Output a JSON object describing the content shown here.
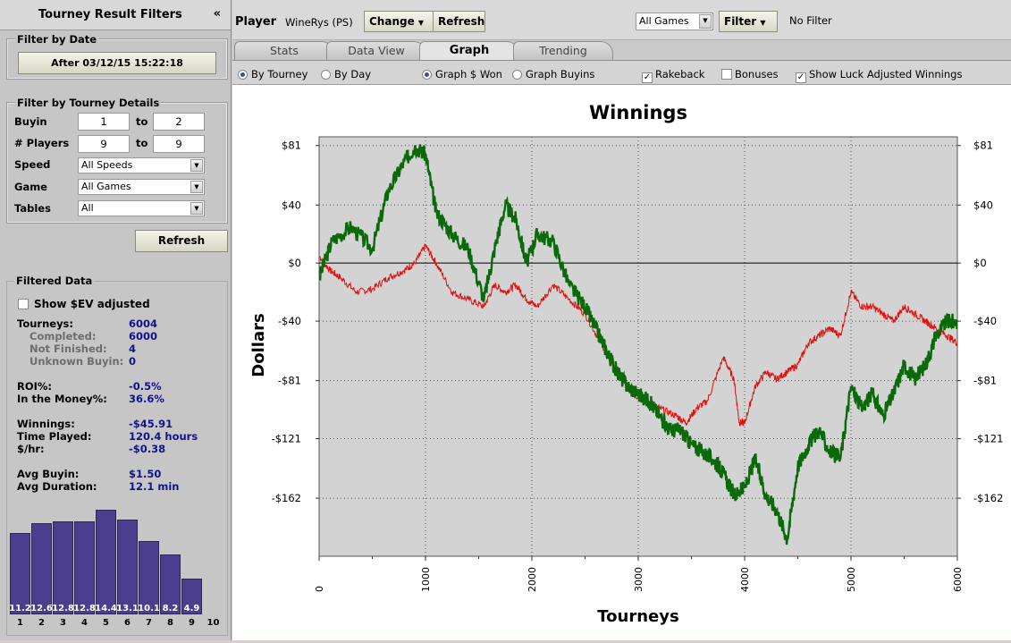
{
  "sidebar": {
    "title": "Tourney Result Filters",
    "collapse_glyph": "«",
    "date_group": {
      "label": "Filter by Date",
      "button": "After 03/12/15 15:22:18"
    },
    "details_group": {
      "label": "Filter by Tourney Details",
      "buyin_label": "Buyin",
      "buyin_from": "1",
      "buyin_to": "2",
      "players_label": "# Players",
      "players_from": "9",
      "players_to": "9",
      "to": "to",
      "speed_label": "Speed",
      "speed_value": "All Speeds",
      "game_label": "Game",
      "game_value": "All Games",
      "tables_label": "Tables",
      "tables_value": "All"
    },
    "refresh": "Refresh",
    "filtered": {
      "label": "Filtered Data",
      "ev_label": "Show $EV adjusted",
      "tourneys_label": "Tourneys:",
      "tourneys": "6004",
      "completed_label": "Completed:",
      "completed": "6000",
      "not_finished_label": "Not Finished:",
      "not_finished": "4",
      "unknown_label": "Unknown Buyin:",
      "unknown": "0",
      "roi_label": "ROI%:",
      "roi": "-0.5%",
      "itm_label": "In the Money%:",
      "itm": "36.6%",
      "winnings_label": "Winnings:",
      "winnings": "-$45.91",
      "time_label": "Time Played:",
      "time": "120.4 hours",
      "hr_label": "$/hr:",
      "hr": "-$0.38",
      "avg_buyin_label": "Avg Buyin:",
      "avg_buyin": "$1.50",
      "avg_dur_label": "Avg Duration:",
      "avg_dur": "12.1 min"
    },
    "histogram": {
      "positions": [
        "1",
        "2",
        "3",
        "4",
        "5",
        "6",
        "7",
        "8",
        "9",
        "10"
      ],
      "values": [
        11.2,
        12.6,
        12.8,
        12.8,
        14.4,
        13.1,
        10.1,
        8.2,
        4.9
      ],
      "labels": [
        "11.2",
        "12.6",
        "12.8",
        "12.8",
        "14.4",
        "13.1",
        "10.1",
        "8.2",
        "4.9"
      ]
    }
  },
  "topbar": {
    "player_label": "Player",
    "player": "WineRys (PS)",
    "change": "Change",
    "refresh": "Refresh",
    "games_select": "All Games",
    "filter": "Filter",
    "no_filter": "No Filter"
  },
  "tabs": [
    "Stats",
    "Data View",
    "Graph",
    "Trending"
  ],
  "active_tab": "Graph",
  "options": {
    "by_tourney": "By Tourney",
    "by_day": "By Day",
    "graph_won": "Graph $ Won",
    "graph_buyins": "Graph Buyins",
    "rakeback": "Rakeback",
    "bonuses": "Bonuses",
    "luck": "Show Luck Adjusted Winnings"
  },
  "chart_data": {
    "type": "line",
    "title": "Winnings",
    "xlabel": "Tourneys",
    "ylabel": "Dollars",
    "xlim": [
      0,
      6000
    ],
    "ylim": [
      -202,
      87
    ],
    "x_ticks": [
      "0",
      "1000",
      "2000",
      "3000",
      "4000",
      "5000",
      "6000"
    ],
    "y_ticks": [
      "$81",
      "$40",
      "$0",
      "-$40",
      "-$81",
      "-$121",
      "-$162"
    ],
    "y_tick_values": [
      81,
      40,
      0,
      -40,
      -81,
      -121,
      -162
    ],
    "grid": true,
    "colors": {
      "won": "#0a6a0a",
      "luck": "#e01010"
    },
    "series": [
      {
        "x": [
          0,
          120,
          300,
          500,
          650,
          800,
          900,
          1000,
          1100,
          1250,
          1400,
          1550,
          1650,
          1750,
          1850,
          1950,
          2050,
          2200,
          2350,
          2500,
          2600,
          2700,
          2800,
          2900,
          3000,
          3100,
          3200,
          3300,
          3400,
          3500,
          3600,
          3700,
          3800,
          3900,
          4000,
          4100,
          4200,
          4300,
          4400,
          4500,
          4600,
          4700,
          4800,
          4900,
          5000,
          5100,
          5200,
          5300,
          5400,
          5500,
          5600,
          5700,
          5800,
          5900,
          6000
        ],
        "y": [
          -10,
          15,
          25,
          10,
          50,
          70,
          80,
          75,
          35,
          20,
          10,
          -25,
          10,
          40,
          30,
          0,
          20,
          15,
          -15,
          -30,
          -45,
          -60,
          -75,
          -85,
          -90,
          -95,
          -105,
          -115,
          -115,
          -125,
          -130,
          -135,
          -145,
          -160,
          -155,
          -135,
          -160,
          -170,
          -190,
          -140,
          -125,
          -115,
          -130,
          -135,
          -85,
          -100,
          -90,
          -105,
          -90,
          -70,
          -80,
          -70,
          -50,
          -40,
          -40
        ]
      },
      {
        "x": [
          0,
          100,
          200,
          350,
          500,
          650,
          800,
          900,
          1000,
          1100,
          1250,
          1400,
          1550,
          1650,
          1750,
          1850,
          1950,
          2050,
          2200,
          2350,
          2500,
          2650,
          2800,
          2950,
          3050,
          3200,
          3350,
          3450,
          3550,
          3650,
          3800,
          3900,
          3950,
          4000,
          4100,
          4200,
          4300,
          4400,
          4500,
          4600,
          4700,
          4800,
          4900,
          5000,
          5100,
          5200,
          5300,
          5400,
          5500,
          5600,
          5700,
          5800,
          5900,
          6000
        ],
        "y": [
          5,
          -5,
          -10,
          -20,
          -18,
          -10,
          -5,
          0,
          12,
          0,
          -20,
          -25,
          -30,
          -15,
          -20,
          -15,
          -25,
          -30,
          -15,
          -25,
          -35,
          -55,
          -75,
          -90,
          -95,
          -100,
          -105,
          -110,
          -100,
          -95,
          -65,
          -80,
          -110,
          -110,
          -85,
          -75,
          -80,
          -75,
          -70,
          -55,
          -50,
          -45,
          -50,
          -20,
          -30,
          -30,
          -35,
          -40,
          -30,
          -35,
          -40,
          -45,
          -50,
          -55
        ]
      }
    ]
  }
}
